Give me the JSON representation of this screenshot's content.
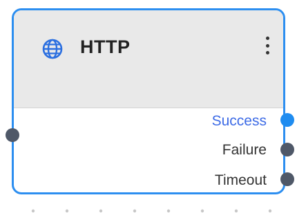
{
  "node": {
    "title": "HTTP",
    "icon": "globe-icon",
    "menu_icon": "more-vertical-icon",
    "accent_color": "#2c8ef0",
    "outputs": [
      {
        "label": "Success",
        "color": "#3d6be6"
      },
      {
        "label": "Failure",
        "color": "#333333"
      },
      {
        "label": "Timeout",
        "color": "#333333"
      }
    ]
  }
}
